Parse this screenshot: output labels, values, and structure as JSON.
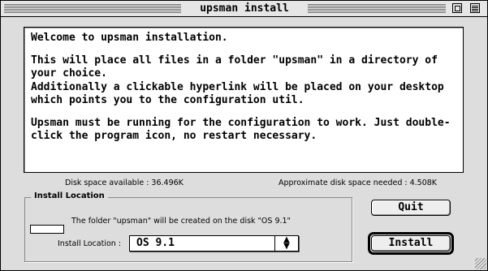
{
  "window": {
    "title": "upsman install"
  },
  "welcome": {
    "line1": "Welcome to upsman installation.",
    "line2": "This will place all files in a folder \"upsman\" in a directory of your choice.",
    "line3": "Additionally a clickable hyperlink will be placed on your desktop which points you to the configuration util.",
    "line4": "Upsman must be running for the configuration to work. Just double-click the program icon, no restart necessary."
  },
  "disk": {
    "available": "Disk space available : 36.496K",
    "needed": "Approximate disk space needed : 4.508K"
  },
  "install_location": {
    "group_label": "Install Location",
    "folder_text": "The folder \"upsman\" will be created on the disk \"OS 9.1\"",
    "popup_label": "Install Location :",
    "popup_value": "OS 9.1"
  },
  "buttons": {
    "quit": "Quit",
    "install": "Install"
  },
  "icons": {
    "popup_arrows": "up-down-arrows-icon",
    "zoom": "zoom-box-icon",
    "collapse": "collapse-box-icon",
    "grow": "grow-box-icon"
  }
}
